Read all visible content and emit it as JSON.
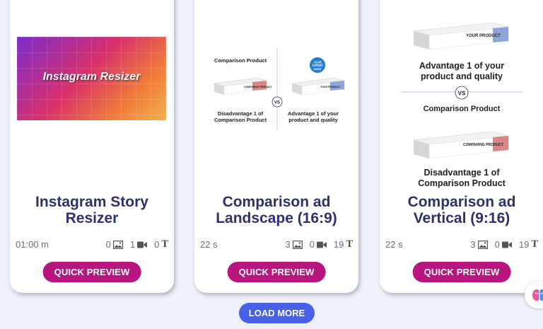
{
  "cards": [
    {
      "title": "Instagram Story Resizer",
      "thumbnail_text": "Instagram Resizer",
      "duration": "01:00 m",
      "images": "0",
      "videos": "1",
      "texts": "0",
      "button": "QUICK PREVIEW"
    },
    {
      "title": "Comparison ad Landscape (16:9)",
      "thumbnail": {
        "left_top": "Comparison Product",
        "left_bottom_1": "Disadvantage 1 of",
        "left_bottom_2": "Comparison Product",
        "right_bottom_1": "Advantage 1 of your",
        "right_bottom_2": "product and quality",
        "logo_1": "YOUR",
        "logo_2": "LOGO",
        "logo_3": "HERE",
        "vs": "VS",
        "box_left": "COMPARING PRODUCT",
        "box_right": "YOUR PRODUCT"
      },
      "duration": "22 s",
      "images": "3",
      "videos": "0",
      "texts": "19",
      "button": "QUICK PREVIEW"
    },
    {
      "title": "Comparison ad Vertical (9:16)",
      "thumbnail": {
        "box_top": "YOUR PRODUCT",
        "adv_1": "Advantage 1 of your",
        "adv_2": "product and quality",
        "vs": "VS",
        "mid": "Comparison Product",
        "box_bottom": "COMPARING PRODUCT",
        "dis_1": "Disadvantage 1 of",
        "dis_2": "Comparison Product"
      },
      "duration": "22 s",
      "images": "3",
      "videos": "0",
      "texts": "19",
      "button": "QUICK PREVIEW"
    }
  ],
  "load_more": "LOAD MORE",
  "colors": {
    "title": "#2e3170",
    "quick_preview": "#b8157e",
    "load_more": "#4760e8",
    "background": "#eef0fa"
  }
}
